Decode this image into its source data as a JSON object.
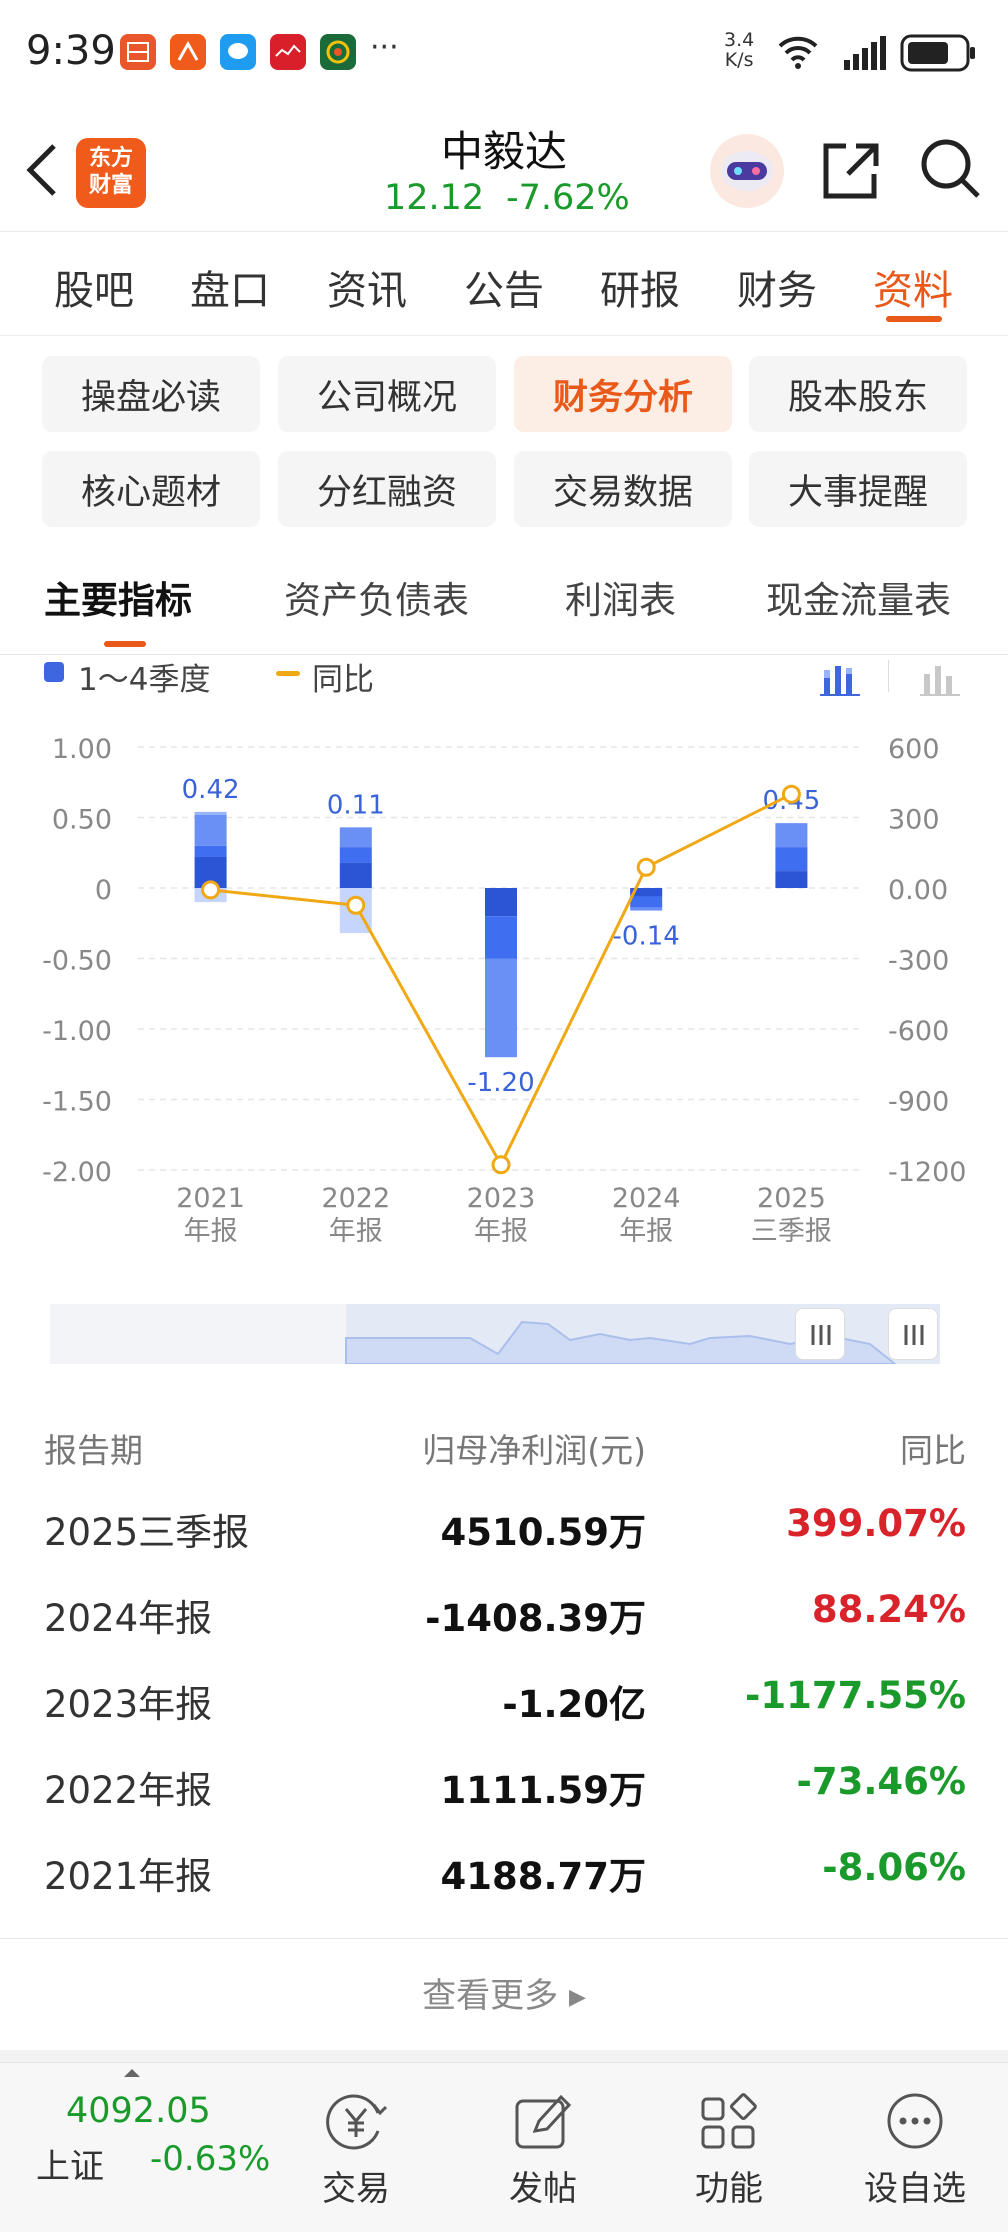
{
  "status": {
    "time": "9:39",
    "net_speed_top": "3.4",
    "net_speed_bottom": "K/s",
    "more": "···"
  },
  "header": {
    "back_icon": "chevron-left-icon",
    "logo_line1": "东方",
    "logo_line2": "财富",
    "stock_name": "中毅达",
    "price": "12.12",
    "change_pct": "-7.62%",
    "down_color": "#1a9a2a"
  },
  "main_tabs": [
    {
      "label": "股吧"
    },
    {
      "label": "盘口"
    },
    {
      "label": "资讯"
    },
    {
      "label": "公告"
    },
    {
      "label": "研报"
    },
    {
      "label": "财务"
    },
    {
      "label": "资料",
      "active": true
    }
  ],
  "sub_chips": [
    {
      "label": "操盘必读"
    },
    {
      "label": "公司概况"
    },
    {
      "label": "财务分析",
      "active": true
    },
    {
      "label": "股本股东"
    },
    {
      "label": "核心题材"
    },
    {
      "label": "分红融资"
    },
    {
      "label": "交易数据"
    },
    {
      "label": "大事提醒"
    }
  ],
  "report_tabs": [
    {
      "label": "主要指标",
      "active": true
    },
    {
      "label": "资产负债表"
    },
    {
      "label": "利润表"
    },
    {
      "label": "现金流量表"
    }
  ],
  "legend": {
    "bars": "1～4季度",
    "line": "同比"
  },
  "chart_data": {
    "type": "bar",
    "categories": [
      "2021\n年报",
      "2022\n年报",
      "2023\n年报",
      "2024\n年报",
      "2025\n三季报"
    ],
    "cat_line1": [
      "2021",
      "2022",
      "2023",
      "2024",
      "2025"
    ],
    "cat_line2": [
      "年报",
      "年报",
      "年报",
      "年报",
      "三季报"
    ],
    "bar_labels": [
      "0.42",
      "0.11",
      "-1.20",
      "-0.14",
      "0.45"
    ],
    "stacks": [
      [
        0.22,
        0.08,
        0.22,
        0.02,
        -0.1
      ],
      [
        0.18,
        0.11,
        0.14,
        0.0,
        -0.32
      ],
      [
        -0.2,
        -0.3,
        -0.7,
        0.0,
        0.0
      ],
      [
        -0.06,
        -0.08,
        -0.02,
        0.0,
        0.0
      ],
      [
        0.12,
        0.17,
        0.17,
        0.0,
        0.0
      ]
    ],
    "series": [
      {
        "name": "同比",
        "values": [
          -8.06,
          -73.46,
          -1177.55,
          88.24,
          399.07
        ]
      }
    ],
    "ylim_left": [
      -2.0,
      1.0
    ],
    "yticks_left": [
      "1.00",
      "0.50",
      "0",
      "-0.50",
      "-1.00",
      "-1.50",
      "-2.00"
    ],
    "ylim_right": [
      -1200,
      600
    ],
    "yticks_right": [
      "600",
      "300",
      "0.00",
      "-300",
      "-600",
      "-900",
      "-1200"
    ],
    "stack_colors": [
      "#2c55d6",
      "#3f6ef0",
      "#6a90f5",
      "#9ab4fa",
      "#c5d5fc"
    ],
    "line_color": "#f1a815",
    "grid": true,
    "legend_position": "top-left"
  },
  "table": {
    "headers": [
      "报告期",
      "归母净利润(元)",
      "同比"
    ],
    "rows": [
      {
        "period": "2025三季报",
        "profit": "4510.59万",
        "yoy": "399.07%",
        "up": true
      },
      {
        "period": "2024年报",
        "profit": "-1408.39万",
        "yoy": "88.24%",
        "up": true
      },
      {
        "period": "2023年报",
        "profit": "-1.20亿",
        "yoy": "-1177.55%",
        "up": false
      },
      {
        "period": "2022年报",
        "profit": "1111.59万",
        "yoy": "-73.46%",
        "up": false
      },
      {
        "period": "2021年报",
        "profit": "4188.77万",
        "yoy": "-8.06%",
        "up": false
      }
    ],
    "up_color": "#d9232b",
    "down_color": "#1a9a2a",
    "more": "查看更多"
  },
  "bottom_bar": {
    "index_value": "4092.05",
    "index_name": "上证",
    "index_change": "-0.63%",
    "items": [
      {
        "label": "交易",
        "icon": "yen-icon"
      },
      {
        "label": "发帖",
        "icon": "edit-icon"
      },
      {
        "label": "功能",
        "icon": "apps-icon"
      },
      {
        "label": "设自选",
        "icon": "more-icon"
      }
    ]
  }
}
